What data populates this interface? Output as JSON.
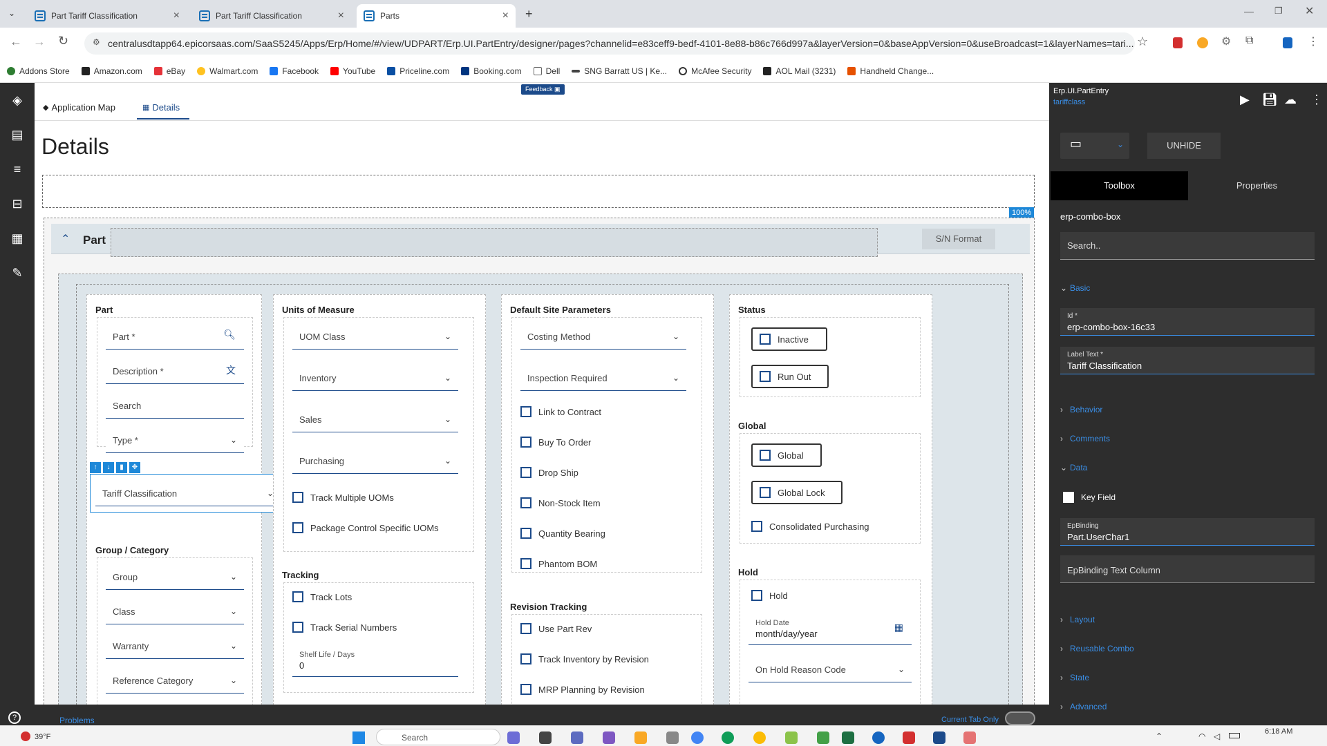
{
  "browser": {
    "tabs": [
      {
        "title": "Part Tariff Classification"
      },
      {
        "title": "Part Tariff Classification"
      },
      {
        "title": "Parts"
      }
    ],
    "new_tab": "+",
    "url": "centralusdtapp64.epicorsaas.com/SaaS5245/Apps/Erp/Home/#/view/UDPART/Erp.UI.PartEntry/designer/pages?channelid=e83ceff9-bedf-4101-8e88-b86c766d997a&layerVersion=0&baseAppVersion=0&useBroadcast=1&layerNames=tari...",
    "bookmarks": [
      {
        "label": "Addons Store",
        "color": "#2e7d32"
      },
      {
        "label": "Amazon.com",
        "color": "#222"
      },
      {
        "label": "eBay",
        "color": "#e53238"
      },
      {
        "label": "Walmart.com",
        "color": "#ffc220"
      },
      {
        "label": "Facebook",
        "color": "#1877f2"
      },
      {
        "label": "YouTube",
        "color": "#ff0000"
      },
      {
        "label": "Priceline.com",
        "color": "#0a4fa3"
      },
      {
        "label": "Booking.com",
        "color": "#003580"
      },
      {
        "label": "Dell",
        "color": "#888"
      },
      {
        "label": "SNG Barratt US | Ke...",
        "color": "#444"
      },
      {
        "label": "McAfee Security",
        "color": "#333"
      },
      {
        "label": "AOL Mail (3231)",
        "color": "#222"
      },
      {
        "label": "Handheld Change...",
        "color": "#e65100"
      }
    ]
  },
  "app": {
    "nav_tabs": [
      "Application Map",
      "Details"
    ],
    "feedback": "Feedback",
    "page_title": "Details",
    "zoom": "100%",
    "panel_title": "Part",
    "sn_format": "S/N Format",
    "part_section": {
      "title": "Part",
      "part_label": "Part *",
      "description_label": "Description *",
      "search_label": "Search",
      "type_label": "Type *",
      "tariff_label": "Tariff Classification"
    },
    "group_section": {
      "title": "Group / Category",
      "group": "Group",
      "class": "Class",
      "warranty": "Warranty",
      "reference": "Reference Category"
    },
    "uom_section": {
      "title": "Units of Measure",
      "uom_class": "UOM Class",
      "inventory": "Inventory",
      "sales": "Sales",
      "purchasing": "Purchasing",
      "track_multiple": "Track Multiple UOMs",
      "package_control": "Package Control Specific UOMs"
    },
    "tracking_section": {
      "title": "Tracking",
      "track_lots": "Track Lots",
      "track_serial": "Track Serial Numbers",
      "shelf_life_label": "Shelf Life / Days",
      "shelf_life_value": "0"
    },
    "site_section": {
      "title": "Default Site Parameters",
      "costing": "Costing Method",
      "inspection": "Inspection Required",
      "link_contract": "Link to Contract",
      "buy_to_order": "Buy To Order",
      "drop_ship": "Drop Ship",
      "non_stock": "Non-Stock Item",
      "quantity_bearing": "Quantity Bearing",
      "phantom_bom": "Phantom BOM"
    },
    "revision_section": {
      "title": "Revision Tracking",
      "use_part_rev": "Use Part Rev",
      "track_inv_rev": "Track Inventory by Revision",
      "mrp_rev": "MRP Planning by Revision"
    },
    "status_section": {
      "title": "Status",
      "inactive": "Inactive",
      "run_out": "Run Out"
    },
    "global_section": {
      "title": "Global",
      "global": "Global",
      "global_lock": "Global Lock",
      "consolidated": "Consolidated Purchasing"
    },
    "hold_section": {
      "title": "Hold",
      "hold": "Hold",
      "hold_date_label": "Hold Date",
      "hold_date_value": "month/day/year",
      "reason": "On Hold Reason Code"
    },
    "bottom": {
      "problems": "Problems",
      "current_tab": "Current Tab Only"
    }
  },
  "right_panel": {
    "app_name": "Erp.UI.PartEntry",
    "layer": "tariffclass",
    "unhide": "UNHIDE",
    "tabs": [
      "Toolbox",
      "Properties"
    ],
    "component": "erp-combo-box",
    "search_placeholder": "Search..",
    "groups": {
      "basic": "Basic",
      "behavior": "Behavior",
      "comments": "Comments",
      "data": "Data",
      "layout": "Layout",
      "reusable": "Reusable Combo",
      "state": "State",
      "advanced": "Advanced"
    },
    "id_label": "Id *",
    "id_value": "erp-combo-box-16c33",
    "label_text_label": "Label Text *",
    "label_text_value": "Tariff Classification",
    "key_field": "Key Field",
    "epbinding_label": "EpBinding",
    "epbinding_value": "Part.UserChar1",
    "epbinding_text_column": "EpBinding Text Column"
  },
  "taskbar": {
    "weather": "39°F",
    "search": "Search",
    "time": "6:18 AM"
  }
}
